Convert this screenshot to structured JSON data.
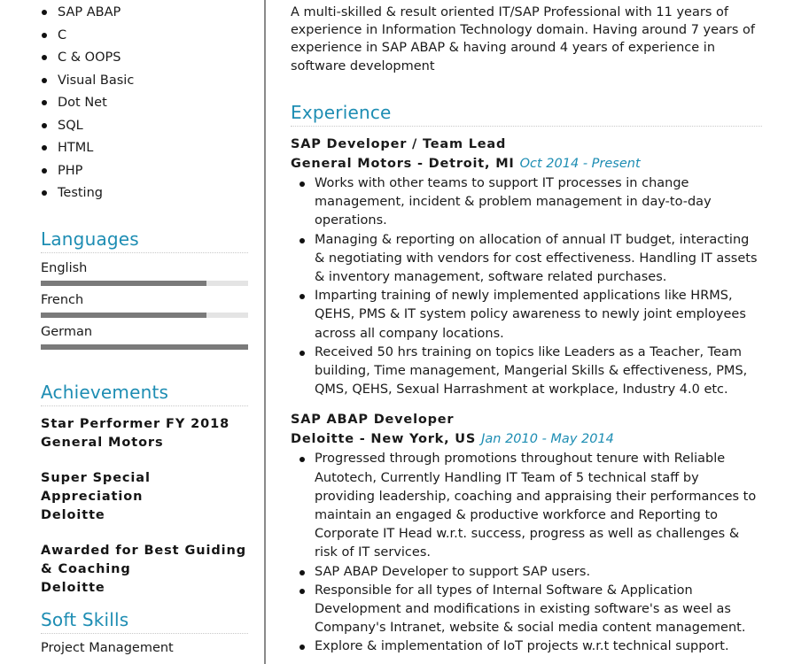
{
  "colors": {
    "accent": "#1d8db3",
    "bar_fill": "#7a7a7a",
    "bar_track": "#e4e4e4",
    "divider": "#8a8a8a"
  },
  "skills": [
    "SAP ABAP",
    "C",
    "C & OOPS",
    "Visual Basic",
    "Dot Net",
    "SQL",
    "HTML",
    "PHP",
    "Testing"
  ],
  "languages": {
    "title": "Languages",
    "items": [
      {
        "name": "English",
        "level": 0.8
      },
      {
        "name": "French",
        "level": 0.8
      },
      {
        "name": "German",
        "level": 1.0
      }
    ]
  },
  "achievements": {
    "title": "Achievements",
    "items": [
      {
        "title": "Star Performer FY 2018",
        "org": "General Motors"
      },
      {
        "title": "Super Special Appreciation",
        "org": "Deloitte"
      },
      {
        "title": "Awarded for Best Guiding & Coaching",
        "org": "Deloitte"
      }
    ]
  },
  "soft_skills": {
    "title": "Soft Skills",
    "items": [
      "Project Management"
    ]
  },
  "summary": "A multi-skilled & result oriented IT/SAP Professional with 11 years of experience in Information Technology domain. Having around 7 years of experience in SAP ABAP & having around 4 years of experience in software development",
  "experience": {
    "title": "Experience",
    "jobs": [
      {
        "title": "SAP Developer / Team Lead",
        "company": "General Motors - Detroit, MI",
        "dates": "Oct 2014 - Present",
        "bullets": [
          "Works with other teams to support IT processes in change management, incident & problem management in day-to-day operations.",
          "Managing & reporting on allocation of annual IT budget, interacting & negotiating with vendors for cost effectiveness. Handling IT assets & inventory management, software related purchases.",
          "Imparting training of newly implemented applications like HRMS, QEHS, PMS & IT system policy awareness to newly joint employees across all company locations.",
          "Received 50 hrs training on topics like Leaders as a Teacher, Team building, Time management, Mangerial Skills & effectiveness, PMS, QMS, QEHS, Sexual Harrashment at workplace, Industry 4.0 etc."
        ]
      },
      {
        "title": "SAP ABAP Developer",
        "company": "Deloitte - New York, US",
        "dates": "Jan 2010 - May 2014",
        "bullets": [
          "Progressed through promotions throughout tenure with Reliable Autotech, Currently Handling IT Team of 5 technical staff by providing leadership, coaching and appraising their performances to maintain an engaged & productive workforce and Reporting to Corporate IT Head w.r.t. success, progress as well as challenges & risk of IT services.",
          "SAP ABAP Developer to support SAP users.",
          "Responsible for all types of Internal Software & Application Development and modifications in existing software's as weel as Company's Intranet, website & social media content management.",
          "Explore & implementation of IoT projects w.r.t technical support."
        ]
      }
    ]
  }
}
